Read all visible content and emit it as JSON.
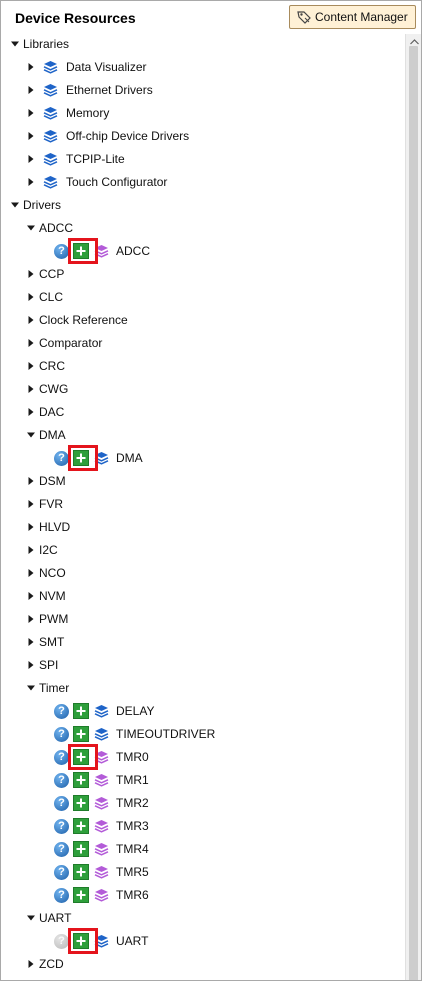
{
  "header": {
    "title": "Device Resources",
    "content_manager_label": "Content Manager"
  },
  "tree": {
    "libraries": {
      "label": "Libraries",
      "items": [
        "Data Visualizer",
        "Ethernet Drivers",
        "Memory",
        "Off-chip Device Drivers",
        "TCPIP-Lite",
        "Touch Configurator"
      ]
    },
    "drivers": {
      "label": "Drivers",
      "adcc": {
        "label": "ADCC",
        "child": "ADCC"
      },
      "collapsed_a": [
        "CCP",
        "CLC",
        "Clock Reference",
        "Comparator",
        "CRC",
        "CWG",
        "DAC"
      ],
      "dma": {
        "label": "DMA",
        "child": "DMA"
      },
      "collapsed_b": [
        "DSM",
        "FVR",
        "HLVD",
        "I2C",
        "NCO",
        "NVM",
        "PWM",
        "SMT",
        "SPI"
      ],
      "timer": {
        "label": "Timer",
        "children": [
          "DELAY",
          "TIMEOUTDRIVER",
          "TMR0",
          "TMR1",
          "TMR2",
          "TMR3",
          "TMR4",
          "TMR5",
          "TMR6"
        ]
      },
      "uart": {
        "label": "UART",
        "child": "UART"
      },
      "zcd": "ZCD"
    }
  },
  "icons": {
    "expanded_arrow": "triangle-down-icon",
    "collapsed_arrow": "triangle-right-icon",
    "library": "blue-stack-icon",
    "module_purple": "purple-stack-icon",
    "help": "help-icon",
    "add": "add-plus-icon"
  },
  "colors": {
    "highlight": "#e4141c",
    "add_green": "#2e9f3b",
    "help_blue": "#2a7cd2",
    "stack_blue": "#1f64c8",
    "stack_purple": "#b35bd8",
    "button_bg": "#fff1d6"
  }
}
